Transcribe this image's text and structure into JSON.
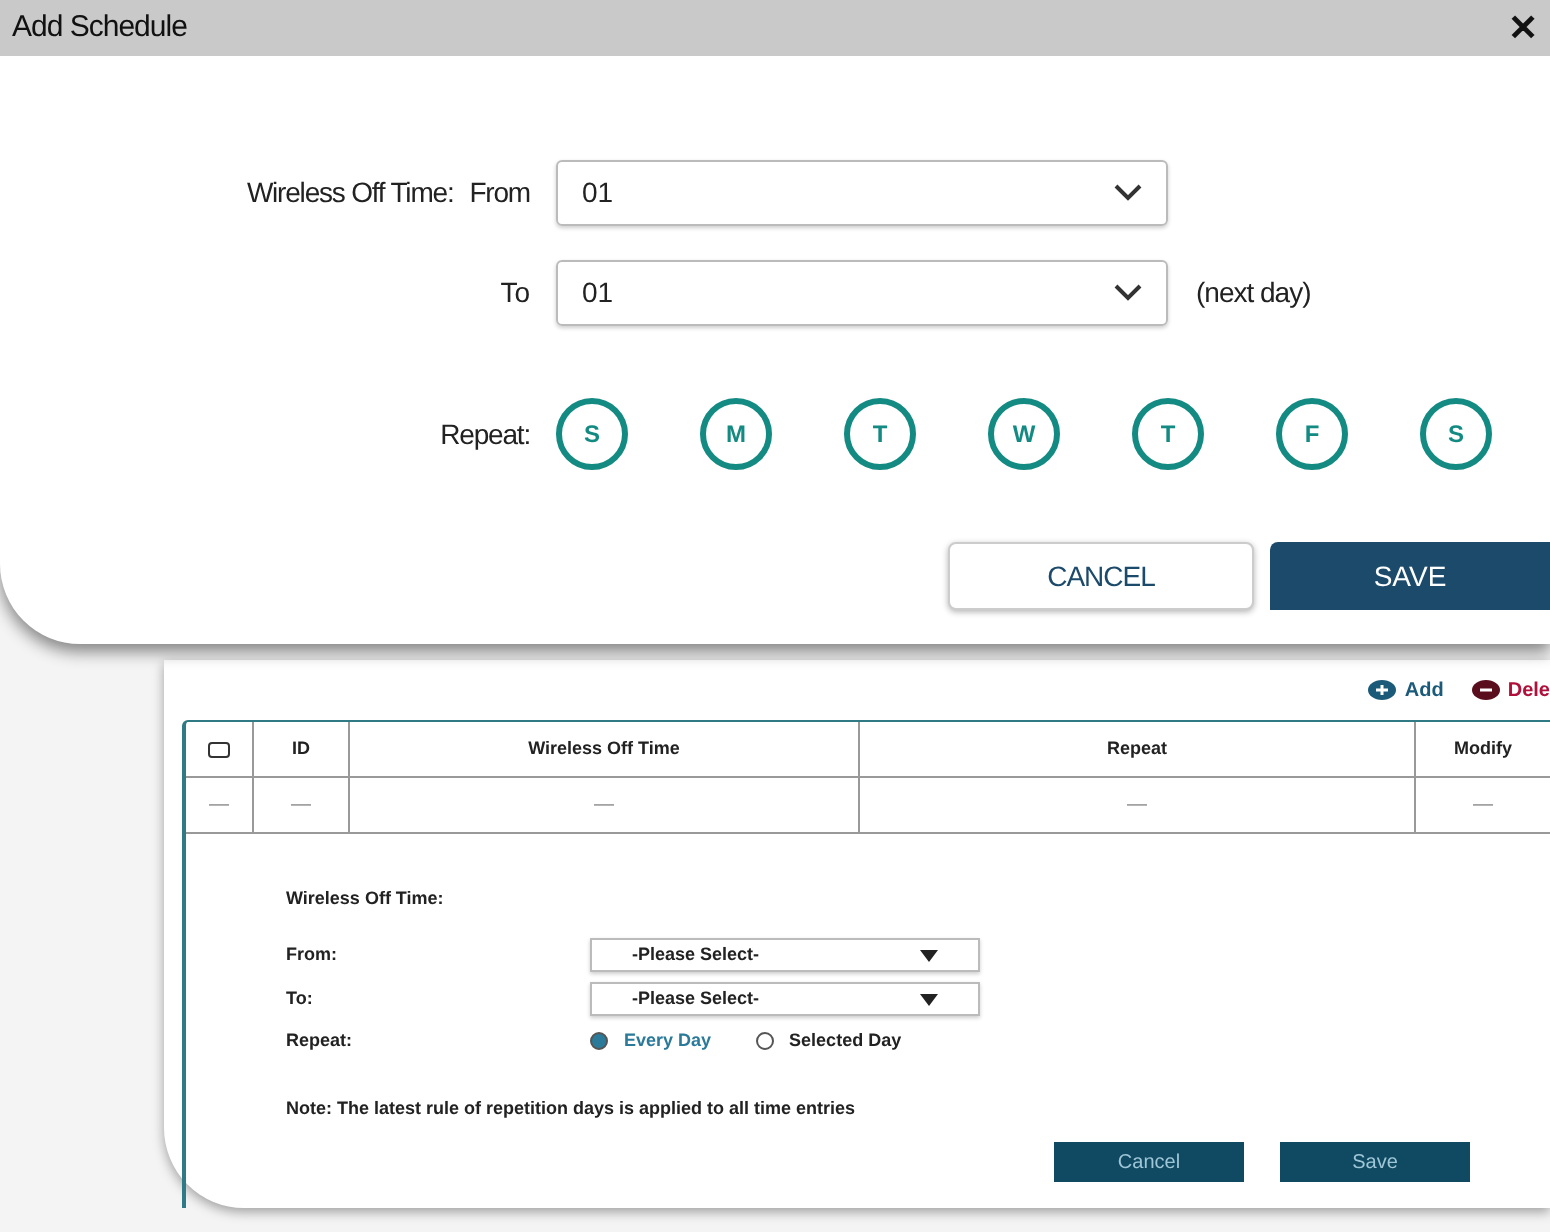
{
  "dialog": {
    "title": "Add Schedule",
    "close": "✕",
    "from": {
      "label": "Wireless Off Time:",
      "sublabel": "From",
      "value": "01"
    },
    "to": {
      "label": "To",
      "value": "01",
      "note": "(next day)"
    },
    "repeat": {
      "label": "Repeat:",
      "days": [
        {
          "label": "S",
          "selected": false
        },
        {
          "label": "M",
          "selected": false
        },
        {
          "label": "T",
          "selected": false
        },
        {
          "label": "W",
          "selected": false
        },
        {
          "label": "T",
          "selected": false
        },
        {
          "label": "F",
          "selected": false
        },
        {
          "label": "S",
          "selected": false
        }
      ]
    },
    "buttons": [
      {
        "label": "CANCEL",
        "kind": "secondary"
      },
      {
        "label": "SAVE",
        "kind": "primary"
      }
    ]
  },
  "background": {
    "actions": [
      {
        "label": "Add",
        "kind": "add"
      },
      {
        "label": "Dele",
        "kind": "delete"
      }
    ],
    "table": {
      "columns": [
        {
          "kind": "checkbox",
          "checked": false
        },
        {
          "kind": "text",
          "label": "ID"
        },
        {
          "kind": "text",
          "label": "Wireless Off Time"
        },
        {
          "kind": "text",
          "label": "Repeat"
        },
        {
          "kind": "text",
          "label": "Modify"
        }
      ],
      "rows": [
        [
          "—",
          "—",
          "—",
          "—",
          "—"
        ]
      ]
    },
    "form": {
      "heading": "Wireless Off Time:",
      "from": {
        "label": "From:",
        "value": "-Please Select-"
      },
      "to": {
        "label": "To:",
        "value": "-Please Select-"
      },
      "repeat": {
        "label": "Repeat:",
        "options": [
          {
            "label": "Every Day",
            "selected": true
          },
          {
            "label": "Selected Day",
            "selected": false
          }
        ]
      },
      "note": "Note: The latest rule of repetition days is applied to all time entries",
      "buttons": [
        "Cancel",
        "Save"
      ]
    }
  }
}
